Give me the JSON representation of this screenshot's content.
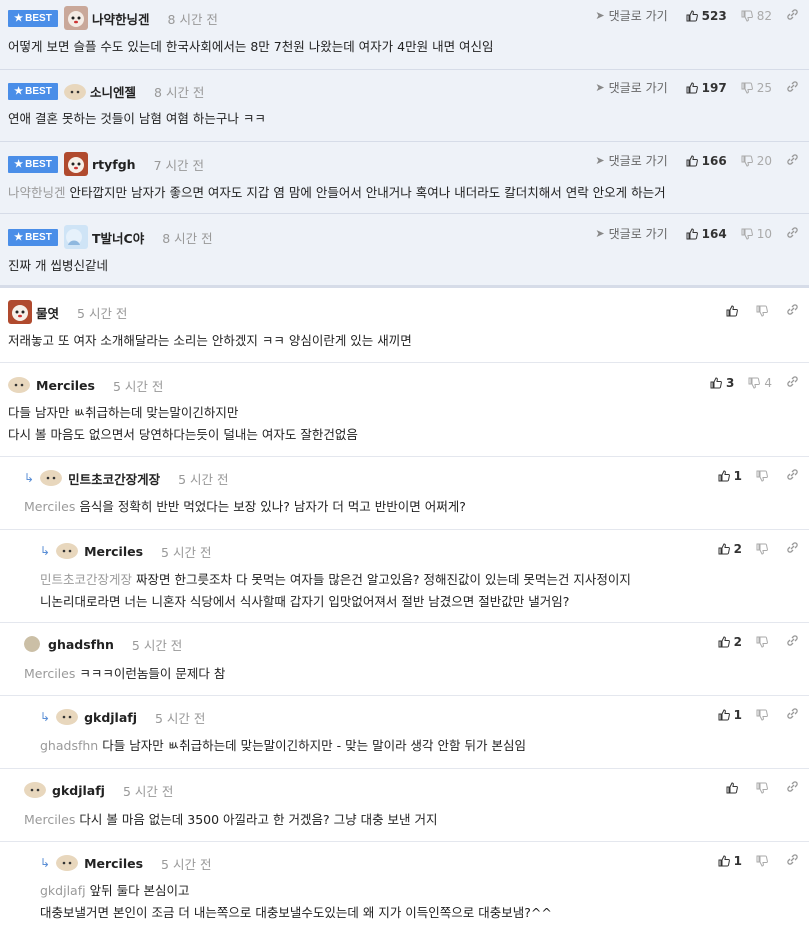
{
  "ui": {
    "best_label": "BEST",
    "goto_label": "댓글로 가기",
    "colors": {
      "badge": "#4a8ee8",
      "best_bg": "#eef2f8",
      "mention": "#9a9a9a"
    }
  },
  "comments": [
    {
      "best": true,
      "name": "나약한닝겐",
      "time": "8 시간 전",
      "mention": "",
      "lines": [
        "어떻게 보면 슬플 수도 있는데 한국사회에서는 8만 7천원 나왔는데 여자가 4만원 내면 여신임"
      ],
      "up": "523",
      "down": "82"
    },
    {
      "best": true,
      "name": "소니엔젤",
      "time": "8 시간 전",
      "mention": "",
      "lines": [
        "연애 결혼 못하는 것들이 남혐 여혐 하는구나 ㅋㅋ"
      ],
      "up": "197",
      "down": "25"
    },
    {
      "best": true,
      "name": "rtyfgh",
      "time": "7 시간 전",
      "mention": "나약한닝겐",
      "lines": [
        "안타깝지만 남자가 좋으면 여자도 지갑 염 맘에 안들어서 안내거나 혹여나 내더라도 칼더치해서 연락 안오게 하는거"
      ],
      "up": "166",
      "down": "20"
    },
    {
      "best": true,
      "name": "T발너C야",
      "time": "8 시간 전",
      "mention": "",
      "lines": [
        "진짜 개 씹병신같네"
      ],
      "up": "164",
      "down": "10"
    },
    {
      "best": false,
      "name": "물엿",
      "time": "5 시간 전",
      "mention": "",
      "lines": [
        "저래놓고 또 여자 소개해달라는 소리는 안하겠지 ㅋㅋ 양심이란게 있는 새끼면"
      ],
      "up": "",
      "down": ""
    },
    {
      "best": false,
      "name": "Merciles",
      "time": "5 시간 전",
      "mention": "",
      "lines": [
        "다들 남자만 ㅄ취급하는데 맞는말이긴하지만",
        "다시 볼 마음도 없으면서 당연하다는듯이 덜내는 여자도 잘한건없음"
      ],
      "up": "3",
      "down": "4"
    },
    {
      "best": false,
      "name": "민트초코간장게장",
      "time": "5 시간 전",
      "mention": "Merciles",
      "lines": [
        "음식을 정확히 반반 먹었다는 보장 있나? 남자가 더 먹고 반반이면 어쩌게?"
      ],
      "up": "1",
      "down": ""
    },
    {
      "best": false,
      "name": "Merciles",
      "time": "5 시간 전",
      "mention": "민트초코간장게장",
      "lines": [
        "짜장면 한그릇조차 다 못먹는 여자들 많은건 알고있음? 정해진값이 있는데 못먹는건 지사정이지",
        "니논리대로라면 너는 니혼자 식당에서 식사할때 갑자기 입맛없어져서 절반 남겼으면 절반값만 낼거임?"
      ],
      "up": "2",
      "down": ""
    },
    {
      "best": false,
      "name": "ghadsfhn",
      "time": "5 시간 전",
      "mention": "Merciles",
      "lines": [
        "ㅋㅋㅋ이런놈들이 문제다 참"
      ],
      "up": "2",
      "down": ""
    },
    {
      "best": false,
      "name": "gkdjlafj",
      "time": "5 시간 전",
      "mention": "ghadsfhn",
      "lines": [
        "다들 남자만 ㅄ취급하는데 맞는말이긴하지만 - 맞는 말이라 생각 안함 뒤가 본심임"
      ],
      "up": "1",
      "down": ""
    },
    {
      "best": false,
      "name": "gkdjlafj",
      "time": "5 시간 전",
      "mention": "Merciles",
      "lines": [
        "다시 볼 마음 없는데 3500 아낄라고 한 거겠음? 그냥 대충 보낸 거지"
      ],
      "up": "",
      "down": ""
    },
    {
      "best": false,
      "name": "Merciles",
      "time": "5 시간 전",
      "mention": "gkdjlafj",
      "lines": [
        "앞뒤 둘다 본심이고",
        "대충보낼거면 본인이 조금 더 내는쪽으로 대충보낼수도있는데 왜 지가 이득인쪽으로 대충보냄?^^"
      ],
      "up": "1",
      "down": ""
    }
  ]
}
